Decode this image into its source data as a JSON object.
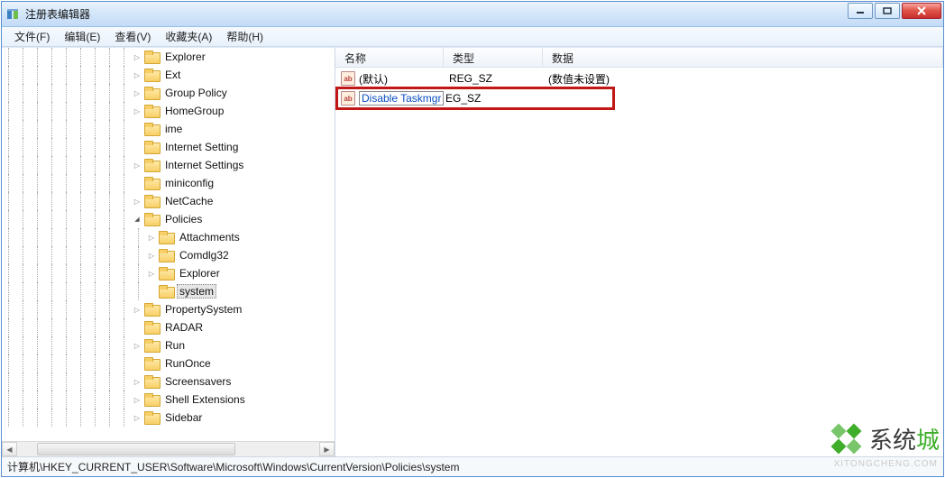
{
  "window": {
    "title": "注册表编辑器"
  },
  "menu": {
    "items": [
      "文件(F)",
      "编辑(E)",
      "查看(V)",
      "收藏夹(A)",
      "帮助(H)"
    ]
  },
  "tree": [
    {
      "indent": 9,
      "toggle": "closed",
      "label": "Explorer"
    },
    {
      "indent": 9,
      "toggle": "closed",
      "label": "Ext"
    },
    {
      "indent": 9,
      "toggle": "closed",
      "label": "Group Policy"
    },
    {
      "indent": 9,
      "toggle": "closed",
      "label": "HomeGroup"
    },
    {
      "indent": 9,
      "toggle": "none",
      "label": "ime"
    },
    {
      "indent": 9,
      "toggle": "none",
      "label": "Internet Setting"
    },
    {
      "indent": 9,
      "toggle": "closed",
      "label": "Internet Settings"
    },
    {
      "indent": 9,
      "toggle": "none",
      "label": "miniconfig"
    },
    {
      "indent": 9,
      "toggle": "closed",
      "label": "NetCache"
    },
    {
      "indent": 9,
      "toggle": "open",
      "label": "Policies"
    },
    {
      "indent": 10,
      "toggle": "closed",
      "label": "Attachments"
    },
    {
      "indent": 10,
      "toggle": "closed",
      "label": "Comdlg32"
    },
    {
      "indent": 10,
      "toggle": "closed",
      "label": "Explorer"
    },
    {
      "indent": 10,
      "toggle": "none",
      "label": "system",
      "selected": true
    },
    {
      "indent": 9,
      "toggle": "closed",
      "label": "PropertySystem"
    },
    {
      "indent": 9,
      "toggle": "none",
      "label": "RADAR"
    },
    {
      "indent": 9,
      "toggle": "closed",
      "label": "Run"
    },
    {
      "indent": 9,
      "toggle": "none",
      "label": "RunOnce"
    },
    {
      "indent": 9,
      "toggle": "closed",
      "label": "Screensavers"
    },
    {
      "indent": 9,
      "toggle": "closed",
      "label": "Shell Extensions"
    },
    {
      "indent": 9,
      "toggle": "closed",
      "label": "Sidebar"
    }
  ],
  "list": {
    "columns": {
      "name": "名称",
      "type": "类型",
      "data": "数据"
    },
    "rows": [
      {
        "icon": "ab",
        "name": "(默认)",
        "type": "REG_SZ",
        "data": "(数值未设置)"
      }
    ],
    "editing": {
      "icon": "ab",
      "value": "Disable Taskmgr",
      "type_suffix": "EG_SZ"
    }
  },
  "statusbar": {
    "path": "计算机\\HKEY_CURRENT_USER\\Software\\Microsoft\\Windows\\CurrentVersion\\Policies\\system"
  },
  "watermark": {
    "text_main": "系统",
    "text_accent": "城",
    "sub": "XITONGCHENG.COM"
  }
}
